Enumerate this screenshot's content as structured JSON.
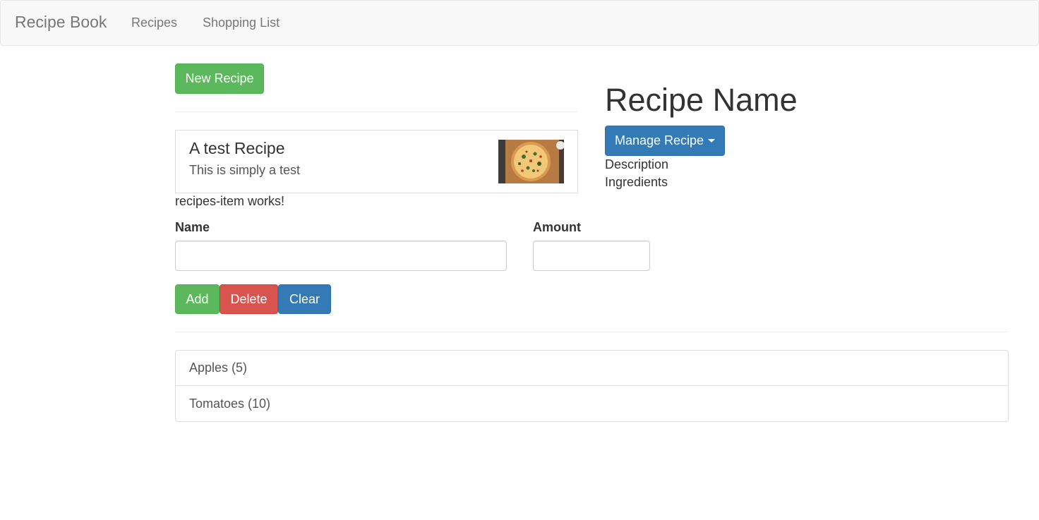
{
  "navbar": {
    "brand": "Recipe Book",
    "links": [
      "Recipes",
      "Shopping List"
    ],
    "background": "#f8f8f8"
  },
  "recipes": {
    "new_button_label": "New Recipe",
    "items": [
      {
        "name": "A test Recipe",
        "description": "This is simply a test",
        "image_icon": "pizza-image"
      }
    ],
    "item_works_text": "recipes-item works!"
  },
  "recipe_detail": {
    "title": "Recipe Name",
    "manage_button_label": "Manage Recipe",
    "description_label": "Description",
    "ingredients_label": "Ingredients"
  },
  "shopping_edit": {
    "name_label": "Name",
    "amount_label": "Amount",
    "name_value": "",
    "amount_value": "",
    "add_label": "Add",
    "delete_label": "Delete",
    "clear_label": "Clear"
  },
  "shopping_list": {
    "items": [
      "Apples (5)",
      "Tomatoes (10)"
    ]
  },
  "colors": {
    "success": "#5cb85c",
    "danger": "#d9534f",
    "primary": "#337ab7"
  }
}
